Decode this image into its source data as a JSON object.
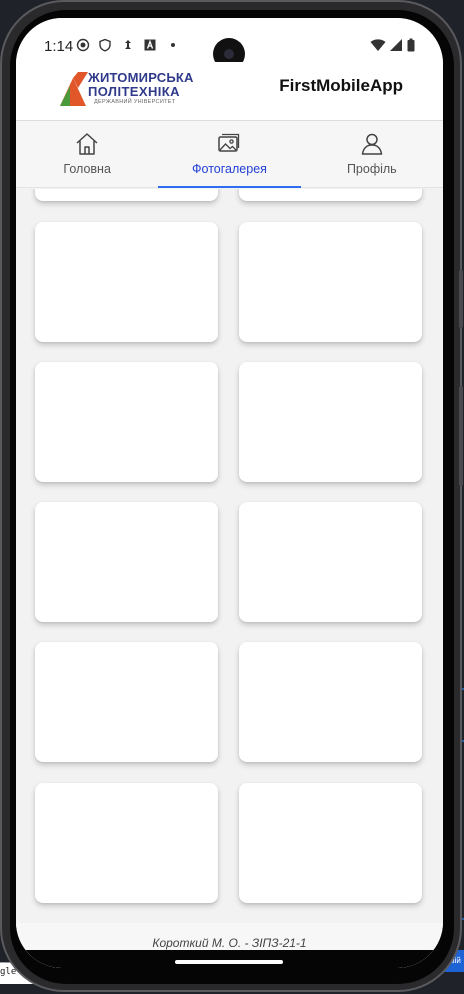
{
  "status_bar": {
    "time": "1:14"
  },
  "header": {
    "logo_line1": "ЖИТОМИРСЬКА",
    "logo_line2": "ПОЛІТЕХНІКА",
    "logo_sub": "ДЕРЖАВНИЙ УНІВЕРСИТЕТ",
    "app_title": "FirstMobileApp"
  },
  "tabs": [
    {
      "label": "Головна",
      "icon": "home-icon",
      "active": false
    },
    {
      "label": "Фотогалерея",
      "icon": "gallery-icon",
      "active": true
    },
    {
      "label": "Профіль",
      "icon": "profile-icon",
      "active": false
    }
  ],
  "footer": {
    "text": "Короткий М. О. - ЗІПЗ-21-1"
  },
  "host": {
    "left_snippet": "gle ",
    "right_snippet": "ь свій"
  },
  "colors": {
    "accent": "#2340d6",
    "indicator": "#2e6df0",
    "logo_blue": "#2f3a8a",
    "logo_orange": "#e2572a",
    "logo_green": "#4a9a3c"
  }
}
